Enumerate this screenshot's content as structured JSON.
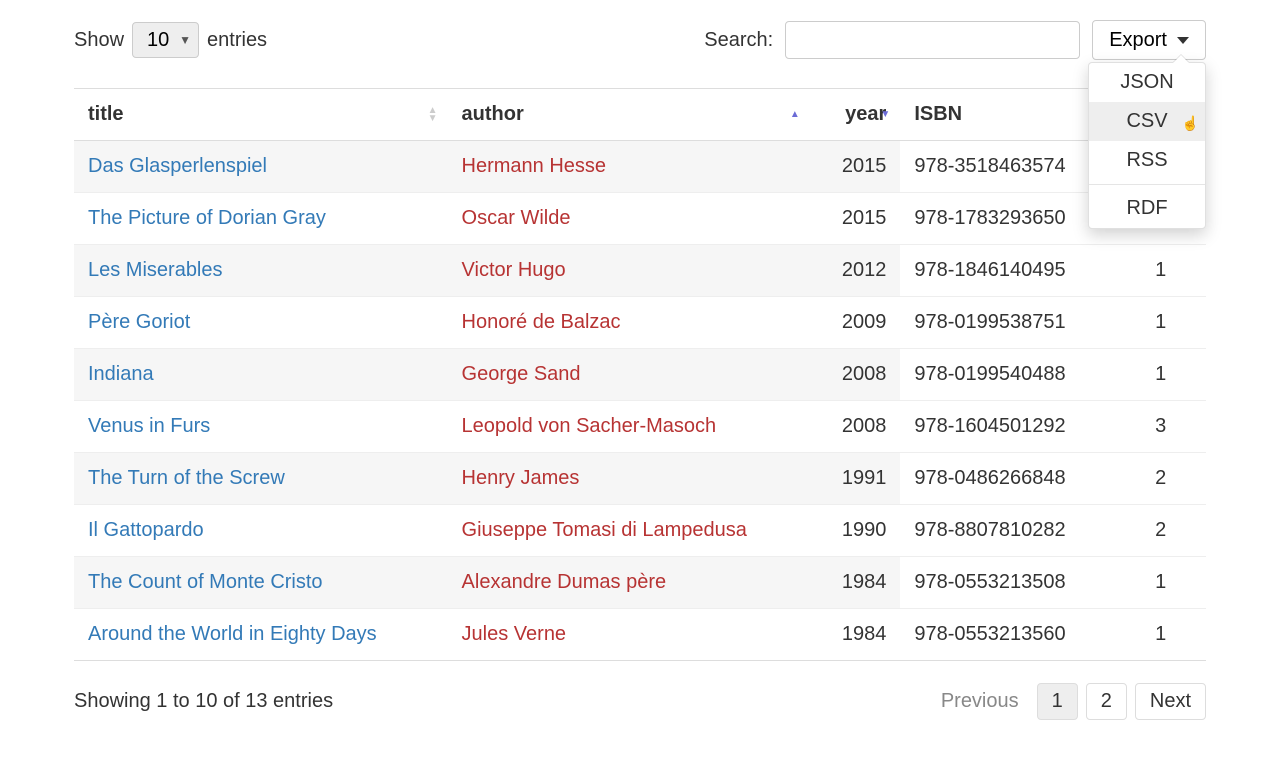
{
  "controls": {
    "show_label_before": "Show",
    "show_label_after": "entries",
    "page_length": "10",
    "search_label": "Search:",
    "export_label": "Export",
    "export_options": [
      "JSON",
      "CSV",
      "RSS",
      "RDF"
    ],
    "export_hover_index": 1
  },
  "columns": {
    "title": "title",
    "author": "author",
    "year": "year",
    "isbn": "ISBN"
  },
  "rows": [
    {
      "title": "Das Glasperlenspiel",
      "author": "Hermann Hesse",
      "year": "2015",
      "isbn": "978-3518463574"
    },
    {
      "title": "The Picture of Dorian Gray",
      "author": "Oscar Wilde",
      "year": "2015",
      "isbn": "978-1783293650"
    },
    {
      "title": "Les Miserables",
      "author": "Victor Hugo",
      "year": "2012",
      "isbn": "978-1846140495",
      "count": "1"
    },
    {
      "title": "Père Goriot",
      "author": "Honoré de Balzac",
      "year": "2009",
      "isbn": "978-0199538751",
      "count": "1"
    },
    {
      "title": "Indiana",
      "author": "George Sand",
      "year": "2008",
      "isbn": "978-0199540488",
      "count": "1"
    },
    {
      "title": "Venus in Furs",
      "author": "Leopold von Sacher-Masoch",
      "year": "2008",
      "isbn": "978-1604501292",
      "count": "3"
    },
    {
      "title": "The Turn of the Screw",
      "author": "Henry James",
      "year": "1991",
      "isbn": "978-0486266848",
      "count": "2"
    },
    {
      "title": "Il Gattopardo",
      "author": "Giuseppe Tomasi di Lampedusa",
      "year": "1990",
      "isbn": "978-8807810282",
      "count": "2"
    },
    {
      "title": "The Count of Monte Cristo",
      "author": "Alexandre Dumas père",
      "year": "1984",
      "isbn": "978-0553213508",
      "count": "1"
    },
    {
      "title": "Around the World in Eighty Days",
      "author": "Jules Verne",
      "year": "1984",
      "isbn": "978-0553213560",
      "count": "1"
    }
  ],
  "footer": {
    "info": "Showing 1 to 10 of 13 entries",
    "previous": "Previous",
    "next": "Next",
    "pages": [
      "1",
      "2"
    ],
    "current_page_index": 0
  }
}
